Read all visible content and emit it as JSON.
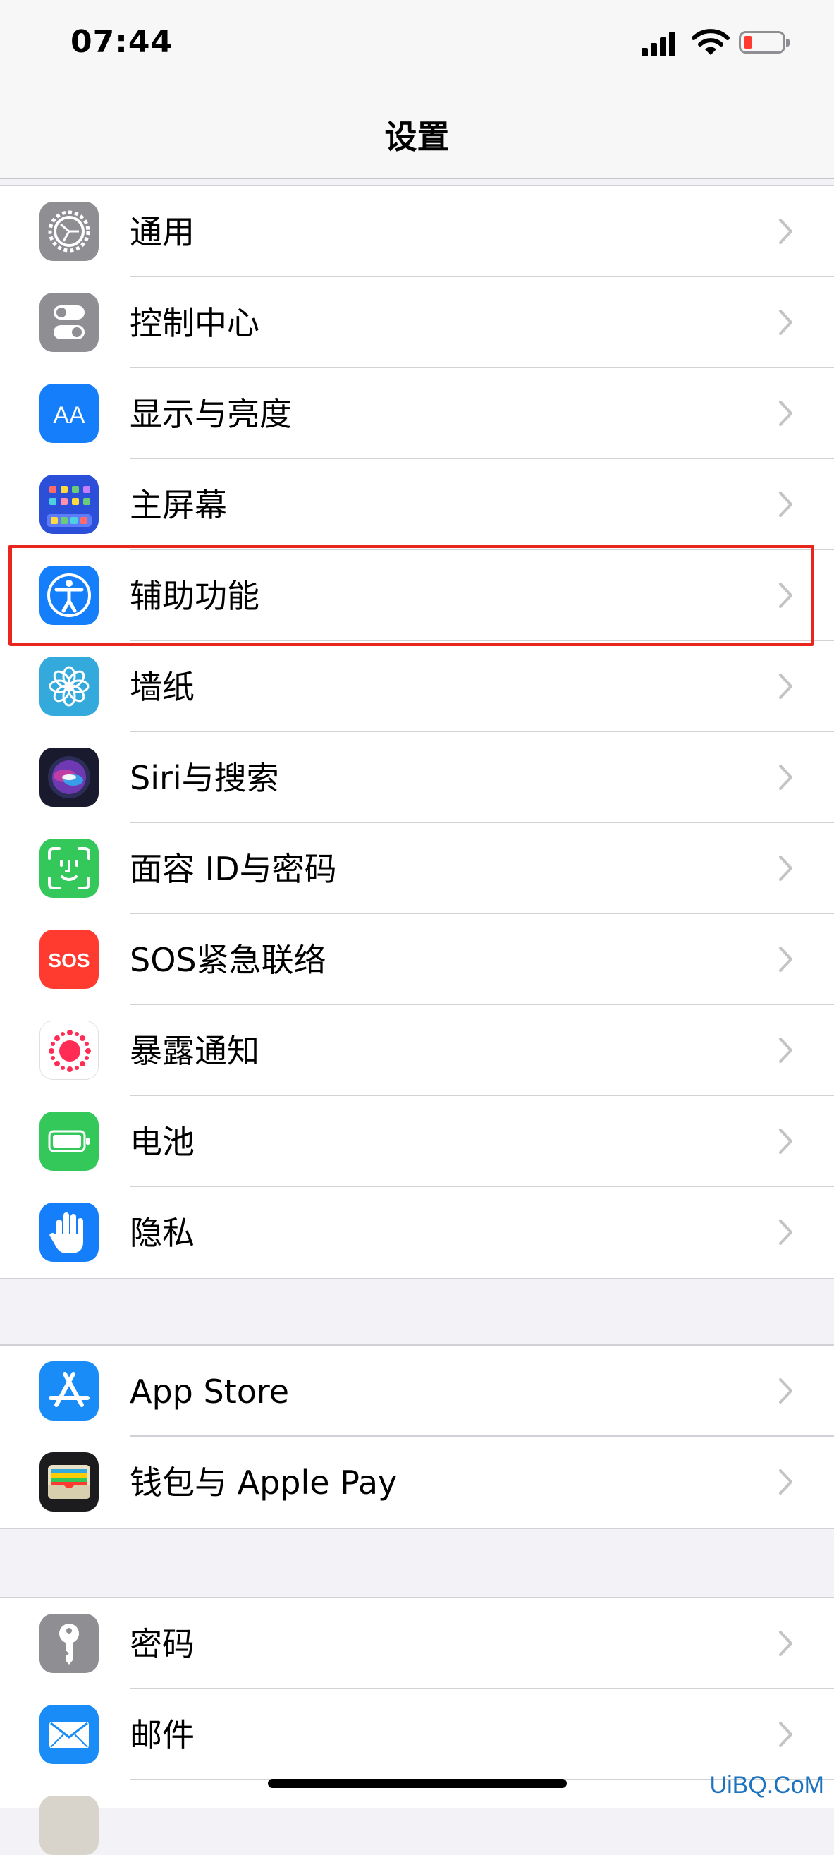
{
  "status_bar": {
    "time": "07:44"
  },
  "nav": {
    "title": "设置"
  },
  "groups": [
    {
      "items": [
        {
          "label": "通用",
          "icon": "gear-icon",
          "color": "#8e8e93"
        },
        {
          "label": "控制中心",
          "icon": "toggles-icon",
          "color": "#8e8e93"
        },
        {
          "label": "显示与亮度",
          "icon": "text-size-icon",
          "color": "#147efb"
        },
        {
          "label": "主屏幕",
          "icon": "home-screen-grid-icon",
          "color": "#2b4fd8"
        },
        {
          "label": "辅助功能",
          "icon": "accessibility-icon",
          "color": "#147efb"
        },
        {
          "label": "墙纸",
          "icon": "flower-icon",
          "color": "#33a9dc"
        },
        {
          "label": "Siri与搜索",
          "icon": "siri-icon",
          "color": "#1a1a2e"
        },
        {
          "label": "面容 ID与密码",
          "icon": "face-id-icon",
          "color": "#34c759"
        },
        {
          "label": "SOS紧急联络",
          "icon": "sos-icon",
          "color": "#ff3b30"
        },
        {
          "label": "暴露通知",
          "icon": "exposure-dots-icon",
          "color": "#ffffff"
        },
        {
          "label": "电池",
          "icon": "battery-icon",
          "color": "#34c759"
        },
        {
          "label": "隐私",
          "icon": "hand-icon",
          "color": "#147efb"
        }
      ]
    },
    {
      "items": [
        {
          "label": "App Store",
          "icon": "app-store-icon",
          "color": "#1a8cf7"
        },
        {
          "label": "钱包与 Apple Pay",
          "icon": "wallet-icon",
          "color": "#1c1c1e"
        }
      ]
    },
    {
      "items": [
        {
          "label": "密码",
          "icon": "key-icon",
          "color": "#8e8e93"
        },
        {
          "label": "邮件",
          "icon": "mail-icon",
          "color": "#1a8cf7"
        }
      ]
    }
  ],
  "highlight_color": "#e8261e",
  "watermark": "UiBQ.CoM"
}
